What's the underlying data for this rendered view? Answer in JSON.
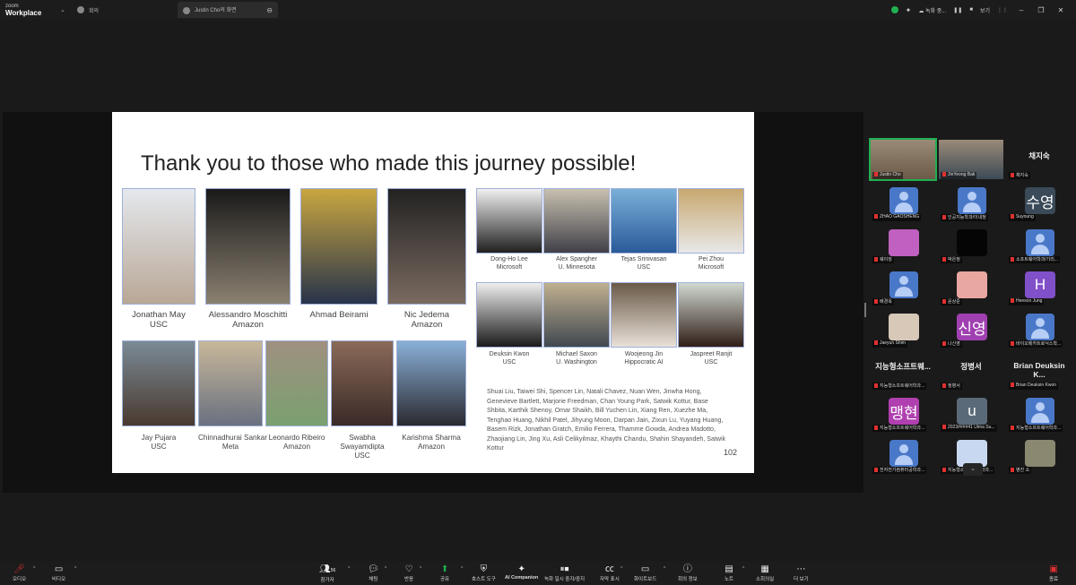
{
  "topbar": {
    "brand_line1": "zoom",
    "brand_line2": "Workplace",
    "tabs": [
      {
        "label": "회의"
      },
      {
        "label": "Justin Cho의 화면"
      }
    ],
    "status_text": "녹화 중...",
    "view_label": "보기"
  },
  "slide": {
    "title": "Thank you to those who made this journey possible!",
    "people_row1": [
      {
        "name": "Jonathan May",
        "org": "USC"
      },
      {
        "name": "Alessandro Moschitti",
        "org": "Amazon"
      },
      {
        "name": "Ahmad Beirami",
        "org": ""
      },
      {
        "name": "Nic Jedema",
        "org": "Amazon"
      }
    ],
    "people_row2": [
      {
        "name": "Jay Pujara",
        "org": "USC"
      },
      {
        "name": "Chinnadhurai Sankar",
        "org": "Meta"
      },
      {
        "name": "Leonardo Ribeiro",
        "org": "Amazon"
      },
      {
        "name": "Swabha Swayamdipta",
        "org": "USC"
      },
      {
        "name": "Karishma Sharma",
        "org": "Amazon"
      }
    ],
    "people_right1": [
      {
        "name": "Dong-Ho Lee",
        "org": "Microsoft"
      },
      {
        "name": "Alex Spangher",
        "org": "U. Minnesota"
      },
      {
        "name": "Tejas Srinivasan",
        "org": "USC"
      },
      {
        "name": "Pei Zhou",
        "org": "Microsoft"
      }
    ],
    "people_right2": [
      {
        "name": "Deuksin Kwon",
        "org": "USC"
      },
      {
        "name": "Michael Saxon",
        "org": "U. Washington"
      },
      {
        "name": "Woojeong Jin",
        "org": "Hippocratic AI"
      },
      {
        "name": "Jaspreet Ranjit",
        "org": "USC"
      }
    ],
    "acknowledgements": "Shuai Liu, Taiwei Shi, Spencer Lin, Natali Chavez, Nuan Wen, Jinwha Hong, Genevieve Bartlett, Marjorie Freedman, Chan Young Park, Satwik Kottur, Base Shbita, Karthik Shenoy, Omar Shaikh, Bill Yuchen Lin, Xiang Ren, Xuezhe Ma, Tenghao Huang, Nikhil Patel, Jihyung Moon, Darpan Jain, Zixun Lu, Yuyang Huang, Basem Rizk, Jonathan Gratch, Emilio Ferrera, Thamme Gowda, Andrea Madotto, Zhaojiang Lin, Jing Xu, Asli Celikyilmaz, Khaythi Chandu,  Shahin Shayandeh, Satwik Kottur",
    "page_number": "102"
  },
  "gallery": [
    {
      "name": "Justin Cho",
      "type": "video",
      "color": "#6b5a48"
    },
    {
      "name": "JinYeong Bak",
      "type": "video",
      "color": "#3c4a55"
    },
    {
      "name": "채지숙",
      "type": "text",
      "display": "채지숙"
    },
    {
      "name": "ZHAO GAOSHENG",
      "type": "avatar"
    },
    {
      "name": "인공지능학과/이내정",
      "type": "avatar"
    },
    {
      "name": "Suyoung",
      "type": "initial",
      "display": "수영",
      "color": "#3a4a58"
    },
    {
      "name": "웨이징",
      "type": "image",
      "color": "#c060c0"
    },
    {
      "name": "박은정",
      "type": "image",
      "color": "#050505"
    },
    {
      "name": "소프트웨어학과/기리...",
      "type": "avatar"
    },
    {
      "name": "배경옥",
      "type": "avatar"
    },
    {
      "name": "윤상준",
      "type": "image",
      "color": "#e8a7a0"
    },
    {
      "name": "Heesoo Jung",
      "type": "initial",
      "display": "H",
      "color": "#8050c8"
    },
    {
      "name": "Jaeyun Shim",
      "type": "image",
      "color": "#d8c8b8"
    },
    {
      "name": "나신영",
      "type": "initial",
      "display": "신영",
      "color": "#a040b0"
    },
    {
      "name": "바이오메카트로닉스학...",
      "type": "avatar"
    },
    {
      "name": "지능형소프트웨어학과...",
      "type": "text",
      "display": "지능형소프트웨..."
    },
    {
      "name": "정병서",
      "type": "text",
      "display": "정병서"
    },
    {
      "name": "Brian Deuksin Kwon",
      "type": "text",
      "display": "Brian Deuksin K..."
    },
    {
      "name": "지능형소프트웨어학과...",
      "type": "initial",
      "display": "맹현",
      "color": "#b040b0"
    },
    {
      "name": "2023####41 Uima Su...",
      "type": "initial",
      "display": "u",
      "color": "#5a6a78"
    },
    {
      "name": "지능형소프트웨어학과...",
      "type": "avatar"
    },
    {
      "name": "전자전기컴퓨터공학과...",
      "type": "avatar"
    },
    {
      "name": "지능형소프트웨어학과...",
      "type": "image",
      "color": "#c8d8f0"
    },
    {
      "name": "병진 소",
      "type": "image",
      "color": "#8a8870"
    }
  ],
  "toolbar": {
    "audio": "오디오",
    "video": "비디오",
    "participants": "참가자",
    "participants_count": "56",
    "chat": "채팅",
    "react": "반응",
    "share": "공유",
    "host_tools": "호스트 도구",
    "ai_companion": "AI Companion",
    "recording": "녹화 일시 중지/중지",
    "captions": "자막 표시",
    "whiteboard": "화이트보드",
    "info": "회의 정보",
    "notes": "노트",
    "breakout": "소회의실",
    "more": "더 보기",
    "end": "종료"
  },
  "colors": {
    "accent_green": "#20b050",
    "end_red": "#e03030",
    "photo_border": "#9fb0d8"
  }
}
